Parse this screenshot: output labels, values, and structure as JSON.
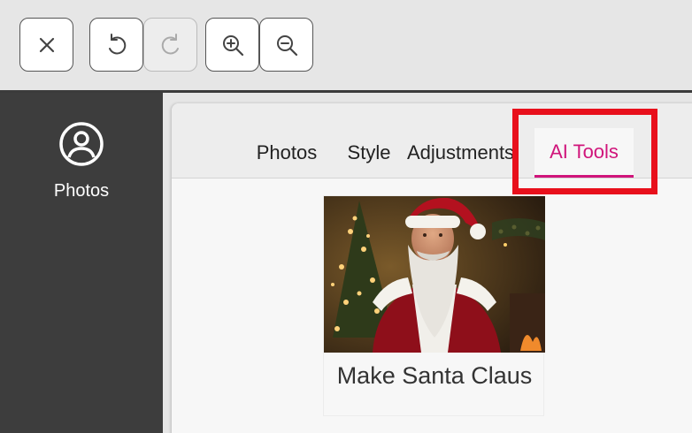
{
  "toolbar": {
    "close": {
      "icon": "close-icon"
    },
    "undo": {
      "icon": "undo-icon"
    },
    "redo": {
      "icon": "redo-icon",
      "disabled": true
    },
    "zoom_in": {
      "icon": "zoom-in-icon"
    },
    "zoom_out": {
      "icon": "zoom-out-icon"
    }
  },
  "sidebar": {
    "items": [
      {
        "label": "Photos",
        "icon": "user-circle-icon"
      }
    ]
  },
  "tabs": [
    {
      "label": "Photos",
      "active": false
    },
    {
      "label": "Style",
      "active": false
    },
    {
      "label": "Adjustments",
      "active": false
    },
    {
      "label": "AI Tools",
      "active": true
    }
  ],
  "cards": [
    {
      "label": "Make Santa Claus"
    }
  ],
  "colors": {
    "accent": "#d0157b",
    "highlight": "#e8101c",
    "sidebar": "#3d3d3d"
  }
}
